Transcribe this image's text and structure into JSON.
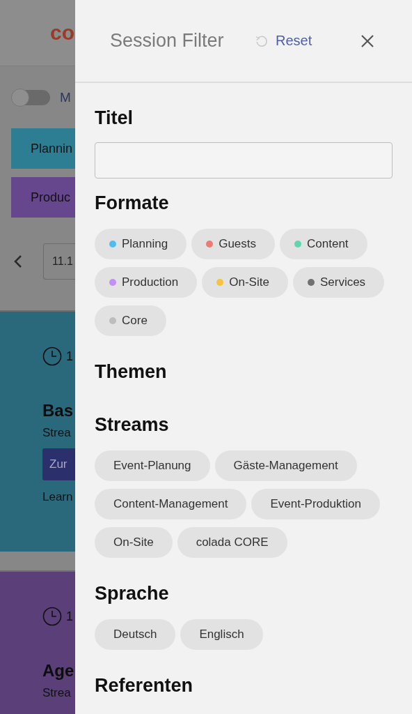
{
  "background_page": {
    "logo": "co",
    "toggle": {
      "on": false,
      "label": "M"
    },
    "format_buttons": [
      {
        "label": "Plannin",
        "color": "#2d7d93"
      },
      {
        "label": "Produc",
        "color": "#66468c"
      }
    ],
    "date_nav": {
      "value": "11.1"
    },
    "session_cards": [
      {
        "time": "1",
        "title": "Bas",
        "stream": "Strea",
        "button": "Zur",
        "link": "Learn",
        "color": "#2a687c"
      },
      {
        "time": "1",
        "title": "Age",
        "stream": "Strea",
        "color": "#5a3f78"
      }
    ]
  },
  "filter_panel": {
    "title": "Session Filter",
    "reset": "Reset",
    "sections": [
      {
        "kind": "text",
        "heading": "Titel"
      },
      {
        "kind": "chips",
        "heading": "Formate",
        "options": [
          {
            "label": "Planning",
            "color": "#4fbdf0",
            "selected": false
          },
          {
            "label": "Guests",
            "color": "#ef7a72",
            "selected": false
          },
          {
            "label": "Content",
            "color": "#5fd6ad",
            "selected": false
          },
          {
            "label": "Production",
            "color": "#c38ef5",
            "selected": false
          },
          {
            "label": "On-Site",
            "color": "#f7c23e",
            "selected": false
          },
          {
            "label": "Services",
            "color": "#717171",
            "selected": false
          },
          {
            "label": "Core",
            "color": "#bdbdbd",
            "selected": false
          }
        ]
      },
      {
        "kind": "chips",
        "heading": "Themen"
      },
      {
        "kind": "chips",
        "heading": "Streams",
        "options": [
          {
            "label": "Event-Planung",
            "selected": false
          },
          {
            "label": "Gäste-Management",
            "selected": false
          },
          {
            "label": "Content-Management",
            "selected": false
          },
          {
            "label": "Event-Produktion",
            "selected": false
          },
          {
            "label": "On-Site",
            "selected": false
          },
          {
            "label": "colada CORE",
            "selected": false
          }
        ]
      },
      {
        "kind": "chips",
        "heading": "Sprache",
        "options": [
          {
            "label": "Deutsch",
            "selected": false
          },
          {
            "label": "Englisch",
            "selected": false
          }
        ]
      },
      {
        "kind": "chips",
        "heading": "Referenten"
      }
    ]
  }
}
